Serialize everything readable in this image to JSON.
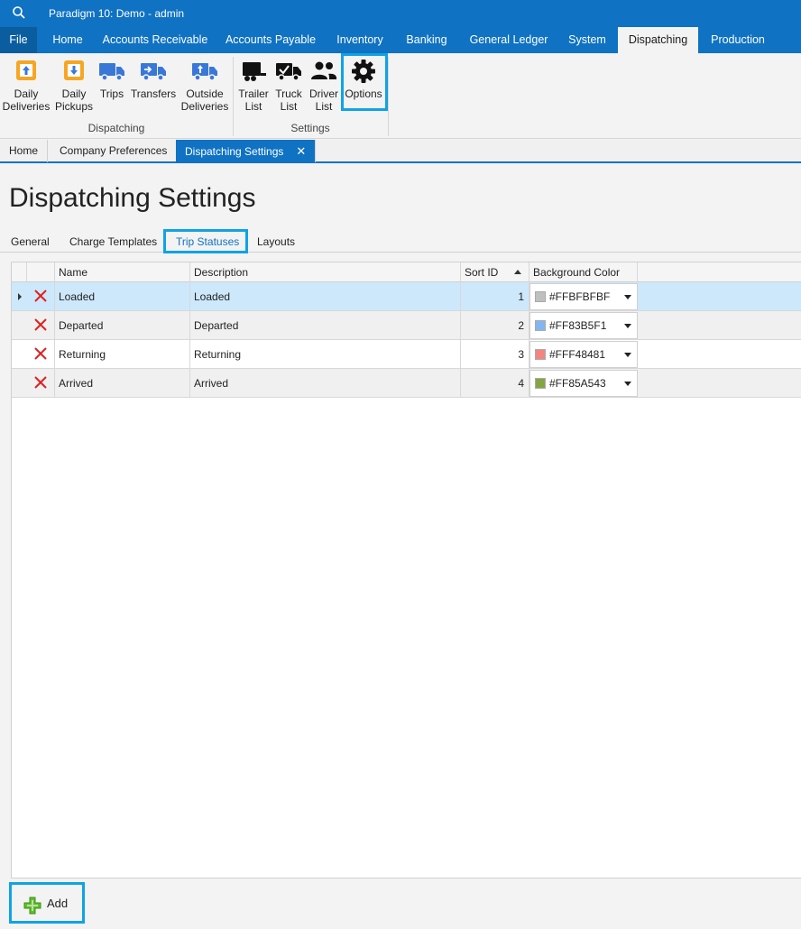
{
  "app": {
    "title": "Paradigm 10: Demo - admin"
  },
  "menu": {
    "file": "File",
    "items": [
      "Home",
      "Accounts Receivable",
      "Accounts Payable",
      "Inventory",
      "Banking",
      "General Ledger",
      "System",
      "Dispatching",
      "Production"
    ],
    "active": "Dispatching"
  },
  "ribbon": {
    "dispatching_group": "Dispatching",
    "settings_group": "Settings",
    "buttons": {
      "daily_deliveries": [
        "Daily",
        "Deliveries"
      ],
      "daily_pickups": [
        "Daily",
        "Pickups"
      ],
      "trips": "Trips",
      "transfers": "Transfers",
      "outside_deliveries": [
        "Outside",
        "Deliveries"
      ],
      "trailer_list": [
        "Trailer",
        "List"
      ],
      "truck_list": [
        "Truck",
        "List"
      ],
      "driver_list": [
        "Driver",
        "List"
      ],
      "options": "Options"
    }
  },
  "doc_tabs": [
    "Home",
    "Company Preferences",
    "Dispatching Settings"
  ],
  "doc_tab_close": "✕",
  "page_title": "Dispatching Settings",
  "sub_tabs": [
    "General",
    "Charge Templates",
    "Trip Statuses",
    "Layouts"
  ],
  "grid": {
    "columns": [
      "Name",
      "Description",
      "Sort ID",
      "Background Color"
    ],
    "rows": [
      {
        "name": "Loaded",
        "description": "Loaded",
        "sort_id": "1",
        "color_label": "#FFBFBFBF",
        "swatch": "#BFBFBF"
      },
      {
        "name": "Departed",
        "description": "Departed",
        "sort_id": "2",
        "color_label": "#FF83B5F1",
        "swatch": "#83B5F1"
      },
      {
        "name": "Returning",
        "description": "Returning",
        "sort_id": "3",
        "color_label": "#FFF48481",
        "swatch": "#F48481"
      },
      {
        "name": "Arrived",
        "description": "Arrived",
        "sort_id": "4",
        "color_label": "#FF85A543",
        "swatch": "#85A543"
      }
    ]
  },
  "add_button": "Add",
  "colors": {
    "accent": "#0f72c2",
    "highlight": "#0fa3e6",
    "delete": "#e02020",
    "add": "#5fbf2a"
  }
}
